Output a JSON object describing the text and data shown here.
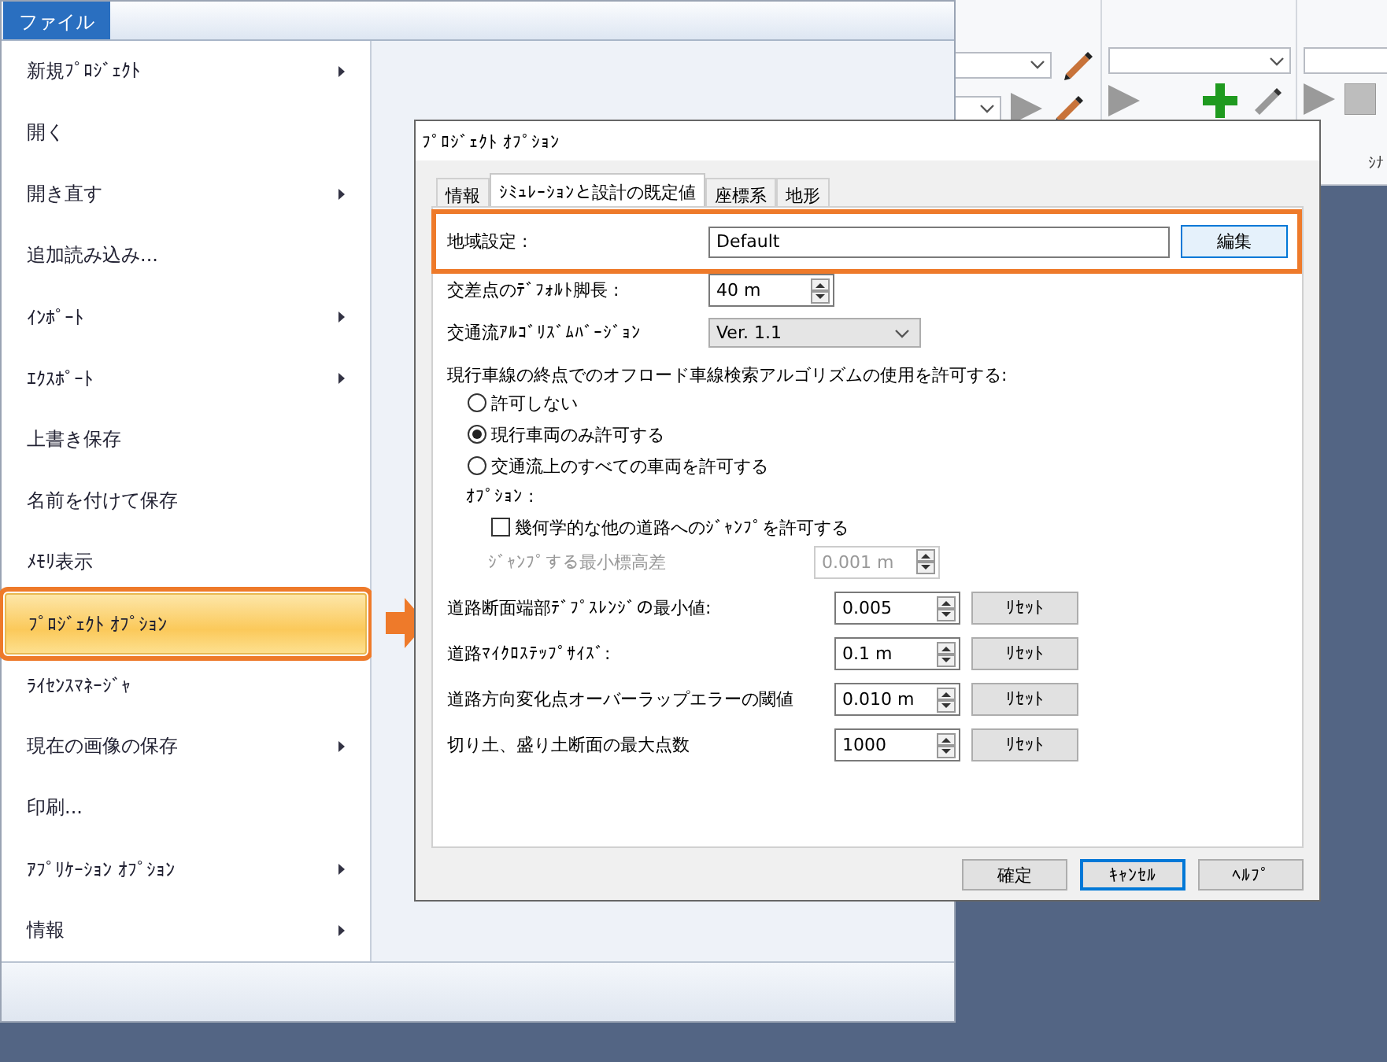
{
  "app_toolbar": {
    "group_label": "ｼﾅ"
  },
  "menu": {
    "title": "ファイル",
    "items": [
      {
        "label": "新規ﾌﾟﾛｼﾞｪｸﾄ",
        "submenu": true,
        "selected": false
      },
      {
        "label": "開く",
        "submenu": false,
        "selected": false
      },
      {
        "label": "開き直す",
        "submenu": true,
        "selected": false
      },
      {
        "label": "追加読み込み...",
        "submenu": false,
        "selected": false
      },
      {
        "label": "ｲﾝﾎﾟｰﾄ",
        "submenu": true,
        "selected": false
      },
      {
        "label": "ｴｸｽﾎﾟｰﾄ",
        "submenu": true,
        "selected": false
      },
      {
        "label": "上書き保存",
        "submenu": false,
        "selected": false
      },
      {
        "label": "名前を付けて保存",
        "submenu": false,
        "selected": false
      },
      {
        "label": "ﾒﾓﾘ表示",
        "submenu": false,
        "selected": false
      },
      {
        "label": "ﾌﾟﾛｼﾞｪｸﾄ ｵﾌﾟｼｮﾝ",
        "submenu": false,
        "selected": true
      },
      {
        "label": "ﾗｲｾﾝｽﾏﾈｰｼﾞｬ",
        "submenu": false,
        "selected": false
      },
      {
        "label": "現在の画像の保存",
        "submenu": true,
        "selected": false
      },
      {
        "label": "印刷...",
        "submenu": false,
        "selected": false
      },
      {
        "label": "ｱﾌﾟﾘｹｰｼｮﾝ ｵﾌﾟｼｮﾝ",
        "submenu": true,
        "selected": false
      },
      {
        "label": "情報",
        "submenu": true,
        "selected": false
      }
    ]
  },
  "dialog": {
    "title": "ﾌﾟﾛｼﾞｪｸﾄ ｵﾌﾟｼｮﾝ",
    "tabs": [
      {
        "label": "情報",
        "selected": false
      },
      {
        "label": "ｼﾐｭﾚｰｼｮﾝと設計の既定値",
        "selected": true
      },
      {
        "label": "座標系",
        "selected": false
      },
      {
        "label": "地形",
        "selected": false
      }
    ],
    "region": {
      "label": "地域設定 :",
      "value": "Default",
      "button": "編集",
      "highlighted": true
    },
    "leg_length": {
      "label": "交差点のﾃﾞﾌｫﾙﾄ脚長 :",
      "value": "40 m"
    },
    "algorithm_version": {
      "label": "交通流ｱﾙｺﾞﾘｽﾞﾑﾊﾞｰｼﾞｮﾝ",
      "value": "Ver. 1.1"
    },
    "offroad": {
      "label": "現行車線の終点でのオフロード車線検索アルゴリズムの使用を許可する:",
      "options": [
        {
          "label": "許可しない",
          "selected": false
        },
        {
          "label": "現行車両のみ許可する",
          "selected": true
        },
        {
          "label": "交通流上のすべての車両を許可する",
          "selected": false
        }
      ]
    },
    "options_label": "ｵﾌﾟｼｮﾝ :",
    "jump": {
      "label": "幾何学的な他の道路へのｼﾞｬﾝﾌﾟを許可する",
      "checked": false
    },
    "min_elevation": {
      "label": "ｼﾞｬﾝﾌﾟする最小標高差",
      "value": "0.001 m",
      "disabled": true
    },
    "params": [
      {
        "label": "道路断面端部ﾃﾞﾌﾟｽﾚﾝｼﾞの最小値:",
        "value": "0.005",
        "button": "ﾘｾｯﾄ"
      },
      {
        "label": "道路ﾏｲｸﾛｽﾃｯﾌﾟｻｲｽﾞ:",
        "value": "0.1 m",
        "button": "ﾘｾｯﾄ"
      },
      {
        "label": "道路方向変化点オーバーラップエラーの閾値",
        "value": "0.010 m",
        "button": "ﾘｾｯﾄ"
      },
      {
        "label": "切り土、盛り土断面の最大点数",
        "value": "1000",
        "button": "ﾘｾｯﾄ"
      }
    ],
    "buttons": [
      {
        "label": "確定",
        "focused": false
      },
      {
        "label": "ｷｬﾝｾﾙ",
        "focused": true
      },
      {
        "label": "ﾍﾙﾌﾟ",
        "focused": false
      }
    ]
  }
}
